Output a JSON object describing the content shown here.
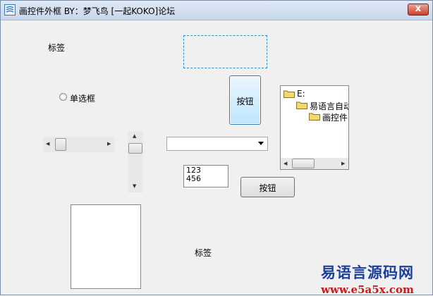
{
  "window": {
    "title": "画控件外框  BY：梦飞鸟   [一起KOKO]论坛",
    "close_symbol": "x"
  },
  "controls": {
    "label_top": "标签",
    "label_bottom": "标签",
    "radio_label": "单选框",
    "button_large": "按钮",
    "button_small": "按钮",
    "combobox_value": "",
    "textbox_lines": [
      "123",
      "456"
    ]
  },
  "tree": {
    "nodes": [
      {
        "label": "E:",
        "level": 0
      },
      {
        "label": "易语言自动",
        "level": 1
      },
      {
        "label": "画控件",
        "level": 2
      }
    ]
  },
  "icons": {
    "app": "app-icon",
    "folder": "folder-icon",
    "scroll_left": "arrow-left-icon",
    "scroll_right": "arrow-right-icon",
    "scroll_up": "arrow-up-icon",
    "scroll_down": "arrow-down-icon",
    "dropdown": "dropdown-arrow-icon"
  },
  "colors": {
    "focus_frame": "#2f8fc0",
    "watermark_blue": "#1c3f9a",
    "watermark_red": "#d01818"
  },
  "watermark": {
    "line1": "易语言源码网",
    "line2": "www.e5a5x.com"
  }
}
